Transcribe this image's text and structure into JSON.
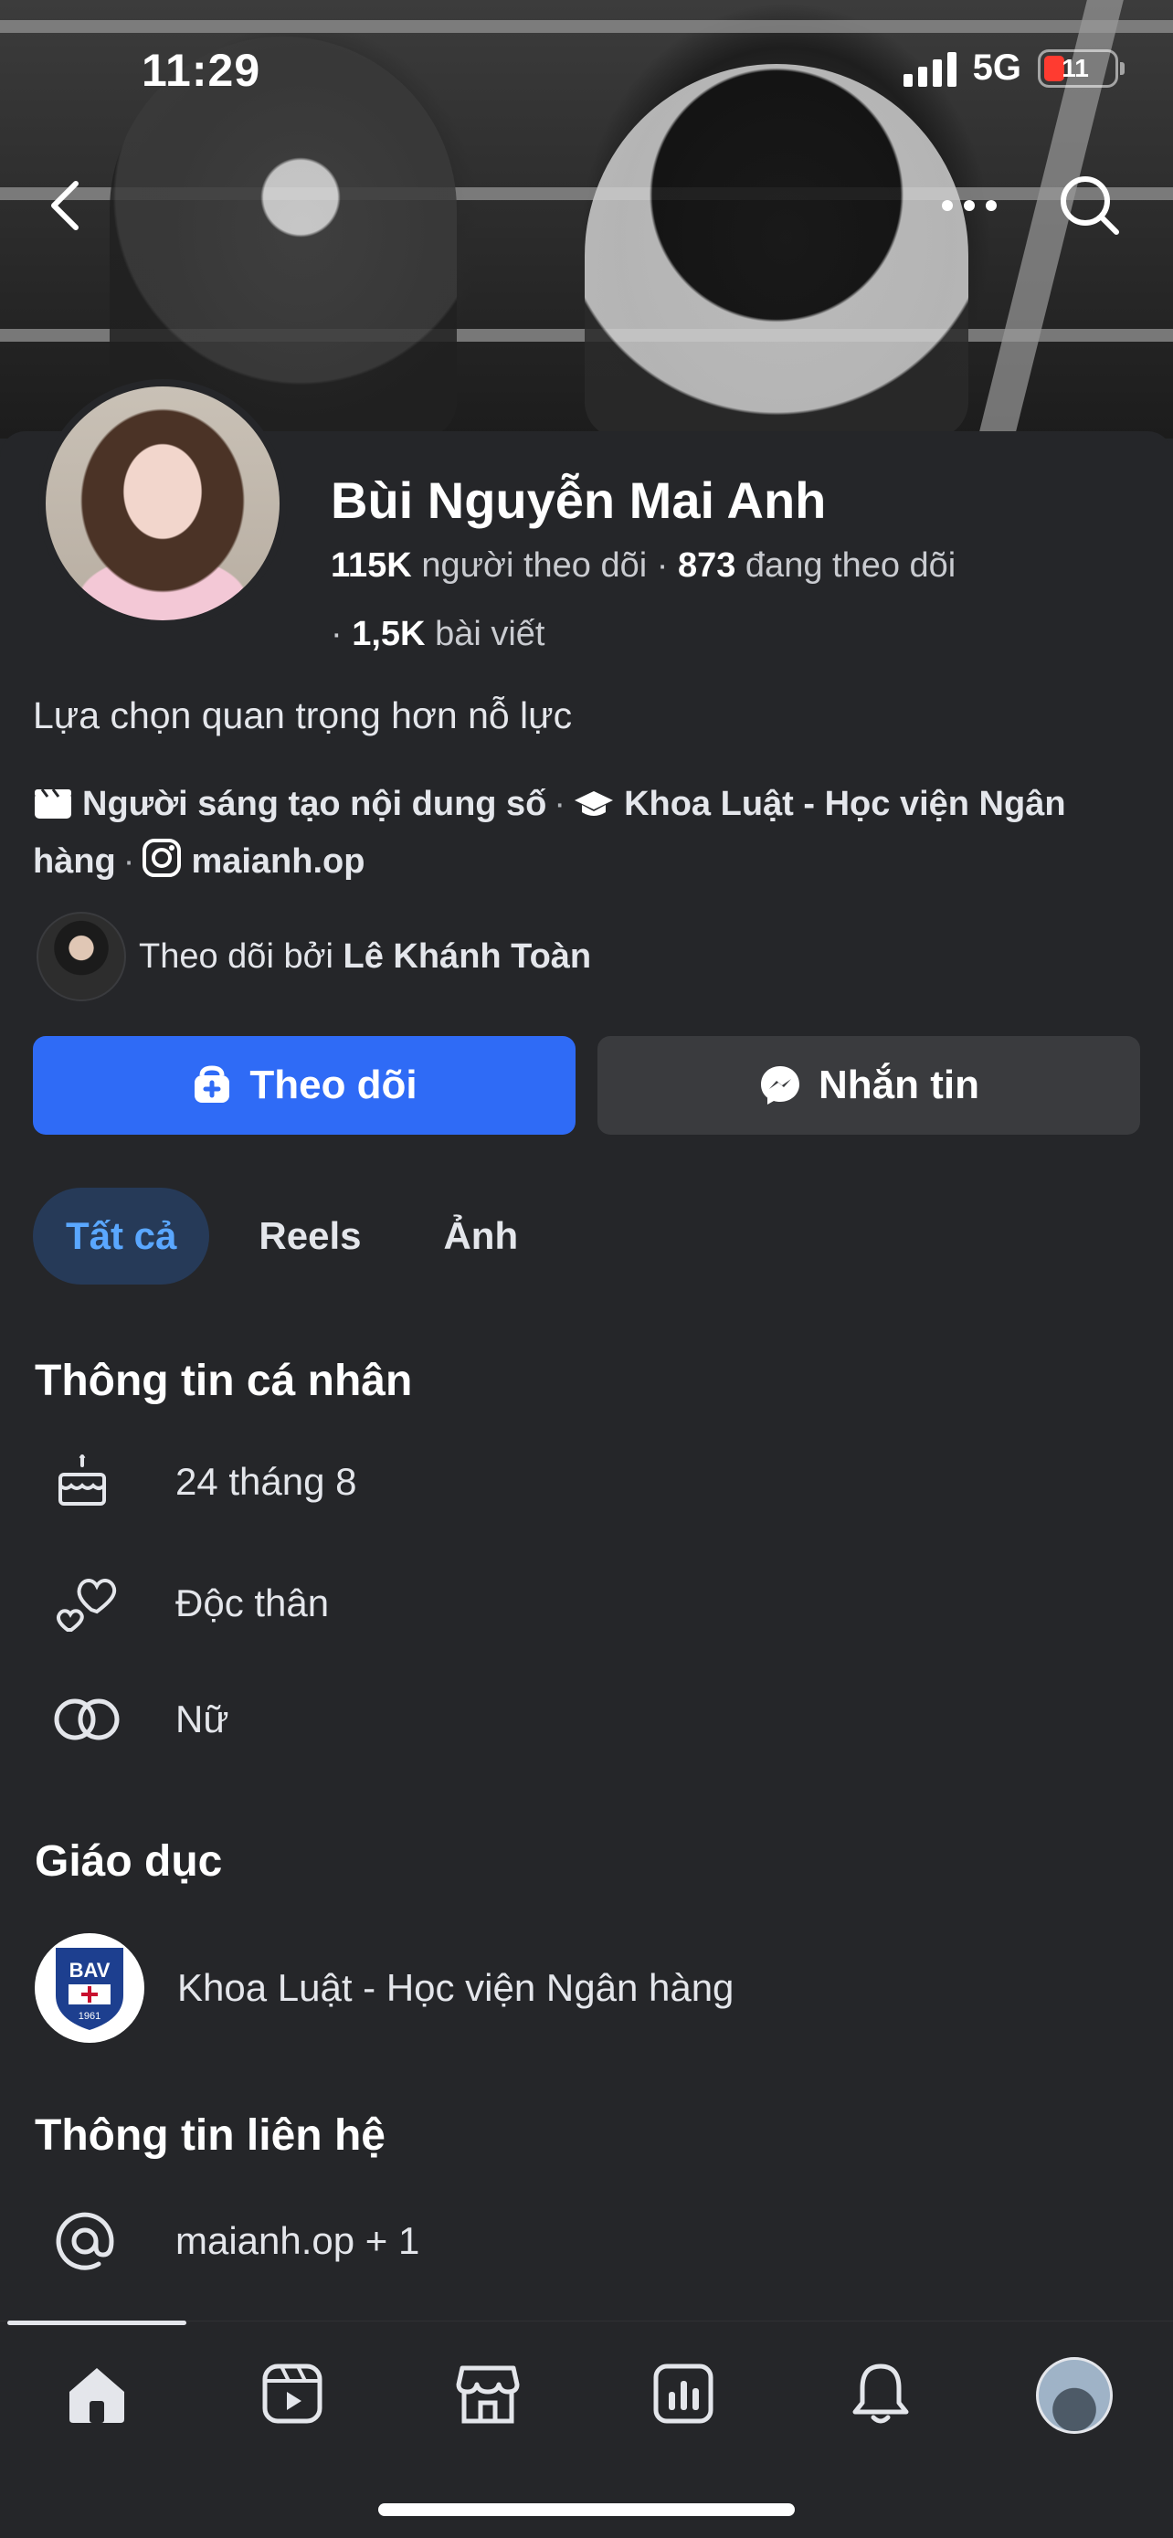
{
  "status_bar": {
    "time": "11:29",
    "network": "5G",
    "battery": "11"
  },
  "profile": {
    "name": "Bùi Nguyễn Mai Anh",
    "followers_count": "115K",
    "followers_label": "người theo dõi",
    "following_count": "873",
    "following_label": "đang theo dõi",
    "posts_count": "1,5K",
    "posts_label": "bài viết",
    "bio": "Lựa chọn quan trọng hơn nỗ lực",
    "intro": {
      "category": "Người sáng tạo nội dung số",
      "school": "Khoa Luật - Học viện Ngân hàng",
      "instagram": "maianh.op"
    },
    "followed_by_prefix": "Theo dõi bởi",
    "followed_by_name": "Lê Khánh Toàn"
  },
  "actions": {
    "follow": "Theo dõi",
    "message": "Nhắn tin"
  },
  "tabs": [
    {
      "label": "Tất cả",
      "active": true
    },
    {
      "label": "Reels",
      "active": false
    },
    {
      "label": "Ảnh",
      "active": false
    }
  ],
  "personal_info": {
    "title": "Thông tin cá nhân",
    "birthday": "24 tháng 8",
    "relationship": "Độc thân",
    "gender": "Nữ"
  },
  "education": {
    "title": "Giáo dục",
    "school": "Khoa Luật - Học viện Ngân hàng",
    "logo_text": "BAV",
    "logo_year": "1961"
  },
  "contact": {
    "title": "Thông tin liên hệ",
    "value": "maianh.op + 1"
  },
  "bottom_nav": [
    "home-icon",
    "video-icon",
    "marketplace-icon",
    "dashboard-icon",
    "notifications-icon",
    "profile-avatar"
  ],
  "colors": {
    "accent": "#2f6bf6",
    "tab_active_text": "#5aa7ff",
    "background": "#252629"
  }
}
